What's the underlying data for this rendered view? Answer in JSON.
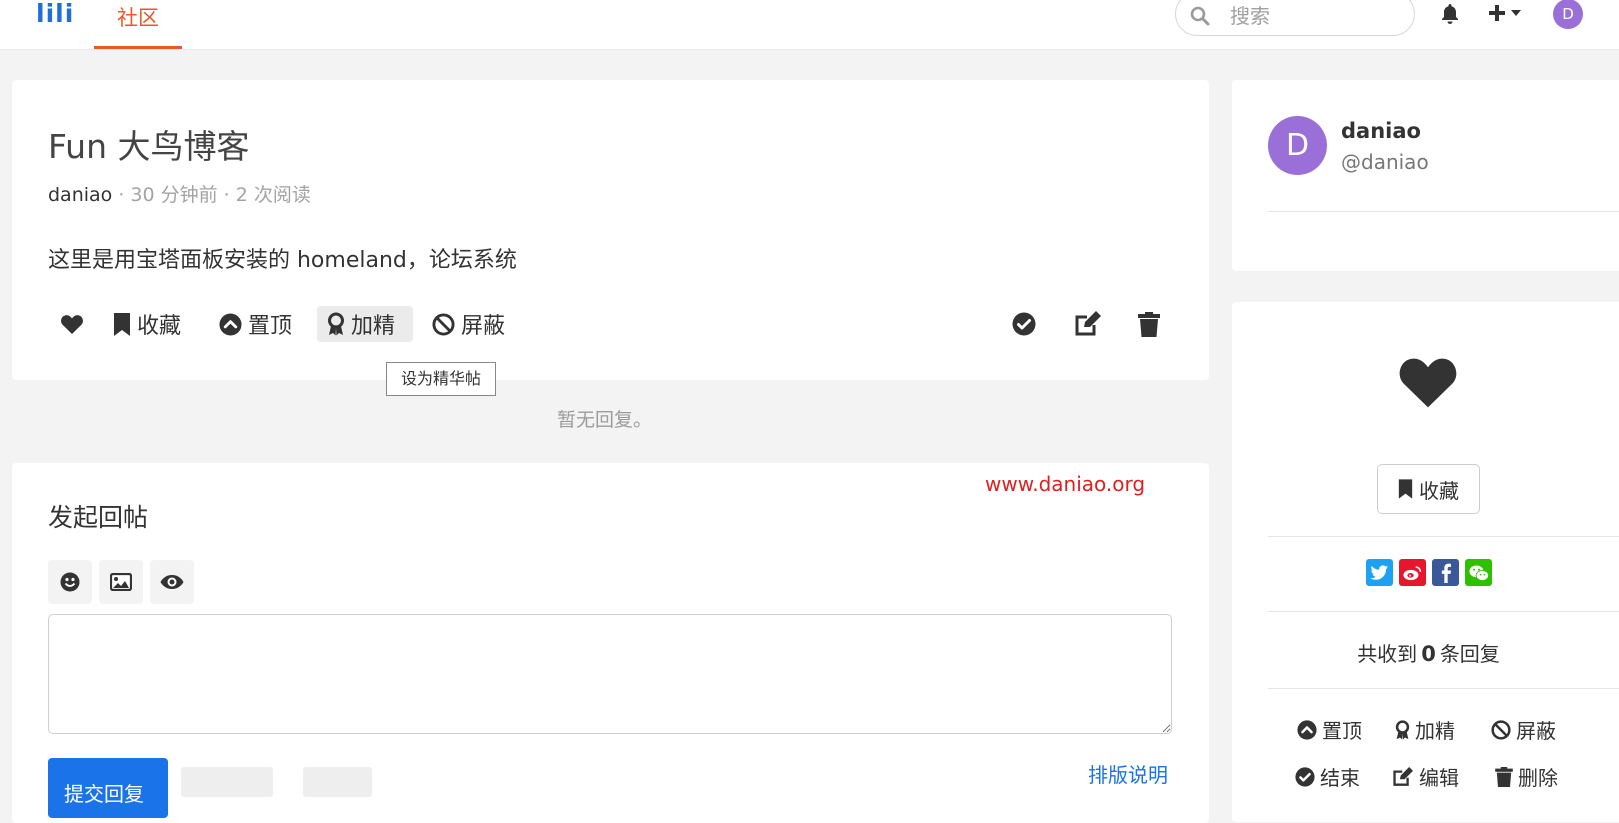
{
  "nav": {
    "logo": "lili",
    "tab_community": "社区",
    "search_placeholder": "搜索",
    "avatar_letter": "D"
  },
  "topic": {
    "title": "Fun 大鸟博客",
    "author": "daniao",
    "meta": " · 30 分钟前 · 2 次阅读",
    "body": "这里是用宝塔面板安装的 homeland，论坛系统",
    "actions": {
      "favorite": "收藏",
      "pin": "置顶",
      "excellent": "加精",
      "ban": "屏蔽"
    },
    "tooltip": "设为精华帖"
  },
  "no_reply": "暂无回复。",
  "watermark": "www.daniao.org",
  "reply": {
    "title": "发起回帖",
    "submit": "提交回复",
    "format_link": "排版说明"
  },
  "author_card": {
    "avatar_letter": "D",
    "name": "daniao",
    "handle": "@daniao"
  },
  "sidebar": {
    "favorite": "收藏",
    "reply_count_prefix": "共收到",
    "reply_count": "0",
    "reply_count_suffix": "条回复",
    "pin": "置顶",
    "excellent": "加精",
    "ban": "屏蔽",
    "close": "结束",
    "edit": "编辑",
    "delete": "删除"
  },
  "colors": {
    "brand": "#1f6fd6",
    "accent_tab": "#e8582b",
    "primary_button": "#1a73e8",
    "avatar": "#9a6fd8",
    "watermark": "#e01f1f",
    "twitter": "#1da1f2",
    "weibo": "#e6162d",
    "facebook": "#3b5998",
    "wechat": "#2dc100"
  },
  "icons": [
    "search-icon",
    "bell-icon",
    "plus-icon",
    "heart-icon",
    "bookmark-icon",
    "chevron-up-circle-icon",
    "award-icon",
    "ban-icon",
    "check-circle-icon",
    "edit-icon",
    "trash-icon",
    "emoji-icon",
    "image-icon",
    "eye-icon",
    "twitter-icon",
    "weibo-icon",
    "facebook-icon",
    "wechat-icon"
  ]
}
